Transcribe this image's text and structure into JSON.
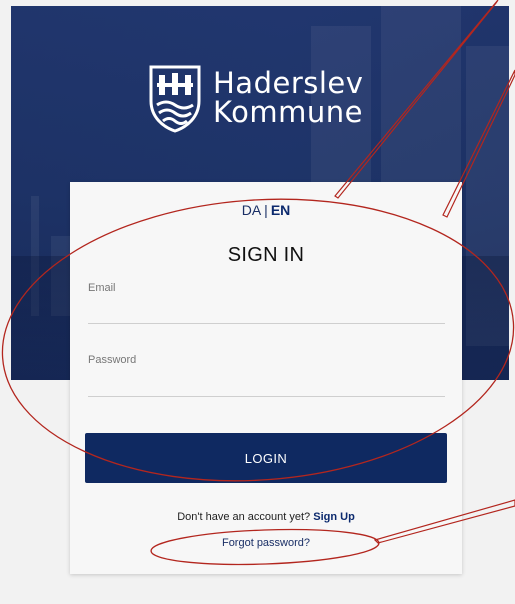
{
  "brand": {
    "line1": "Haderslev",
    "line2": "Kommune",
    "logo_icon": "municipal-shield-icon"
  },
  "language": {
    "options": [
      "DA",
      "EN"
    ],
    "separator": "|",
    "active": "EN"
  },
  "form": {
    "title": "SIGN IN",
    "email_label": "Email",
    "email_value": "",
    "password_label": "Password",
    "password_value": "",
    "login_label": "LOGIN",
    "signup_prompt": "Don't have an account yet?",
    "signup_link": "Sign Up",
    "forgot_link": "Forgot password?"
  },
  "colors": {
    "brand_navy": "#0f2961",
    "hero_blue": "#25407f",
    "annotation_red": "#b3261e",
    "background": "#f2f2f2"
  }
}
